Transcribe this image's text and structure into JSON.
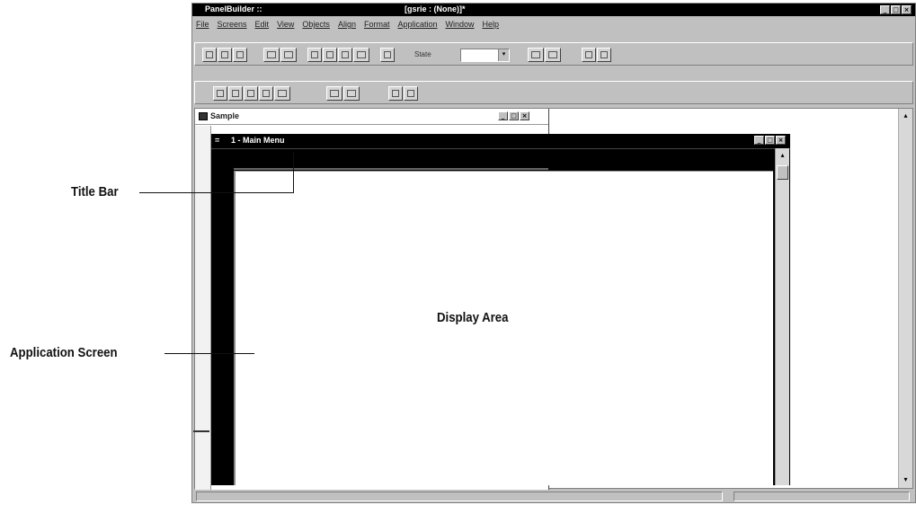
{
  "callouts": {
    "title_bar": "Title Bar",
    "display_area": "Display Area",
    "application_screen": "Application Screen"
  },
  "app_window": {
    "title": "PanelBuilder ::",
    "document_title": "[gsrie : (None)]*",
    "min_glyph": "_",
    "max_glyph": "□",
    "close_glyph": "×"
  },
  "menu": {
    "items": [
      "File",
      "Screens",
      "Edit",
      "View",
      "Objects",
      "Align",
      "Format",
      "Application",
      "Window",
      "Help"
    ]
  },
  "toolbar": {
    "state_label": "State",
    "state_value": "",
    "dropdown_glyph": "▾"
  },
  "sample_window": {
    "title": "Sample"
  },
  "main_menu_window": {
    "system_glyph": "=",
    "title": "1 - Main Menu"
  },
  "scroll": {
    "up_glyph": "▴",
    "down_glyph": "▾"
  },
  "colors": {
    "titlebar": "#000000",
    "chrome": "#c0c0c0",
    "canvas": "#ffffff"
  }
}
